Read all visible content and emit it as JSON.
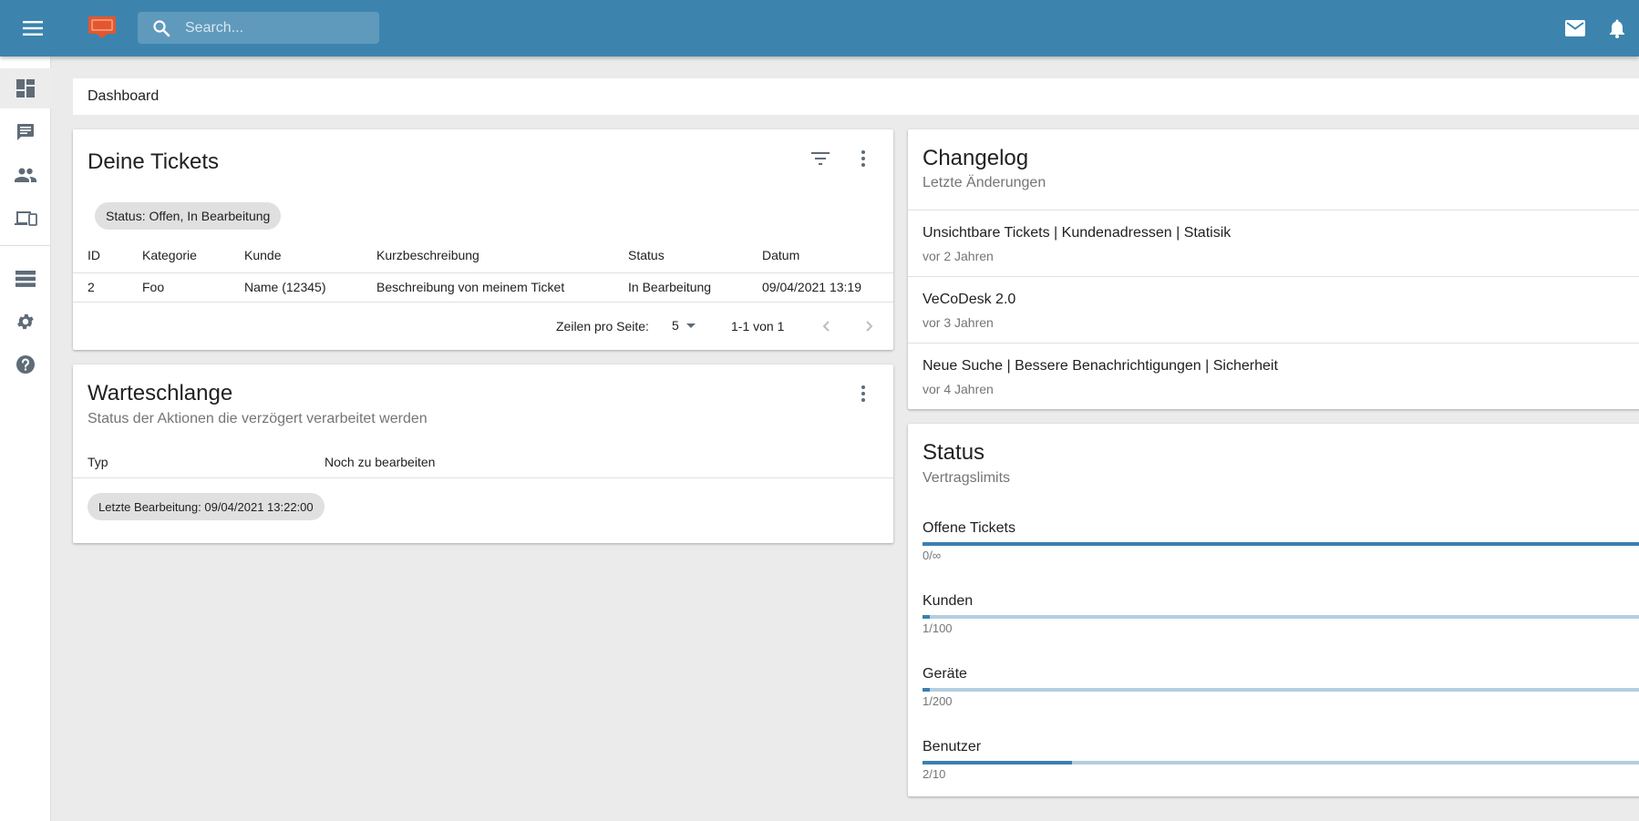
{
  "topbar": {
    "search_placeholder": "Search..."
  },
  "colors": {
    "topbar": "#3c84ae",
    "logo": "#e4572e",
    "progress_fill": "#3c7fb1",
    "progress_track": "#b3cee0"
  },
  "sidebar": {
    "items": [
      {
        "icon": "dashboard-icon",
        "active": true
      },
      {
        "icon": "chat-icon"
      },
      {
        "icon": "people-icon"
      },
      {
        "icon": "devices-icon"
      },
      {
        "icon": "list-icon"
      },
      {
        "icon": "gear-icon"
      },
      {
        "icon": "help-icon"
      }
    ]
  },
  "breadcrumb": {
    "title": "Dashboard"
  },
  "tickets": {
    "title": "Deine Tickets",
    "filter_chip": "Status: Offen, In Bearbeitung",
    "columns": [
      "ID",
      "Kategorie",
      "Kunde",
      "Kurzbeschreibung",
      "Status",
      "Datum"
    ],
    "rows": [
      [
        "2",
        "Foo",
        "Name (12345)",
        "Beschreibung von meinem Ticket",
        "In Bearbeitung",
        "09/04/2021 13:19"
      ]
    ],
    "pagination": {
      "rows_per_page_label": "Zeilen pro Seite:",
      "rows_per_page": "5",
      "range": "1-1 von 1"
    }
  },
  "queue": {
    "title": "Warteschlange",
    "subtitle": "Status der Aktionen die verzögert verarbeitet werden",
    "columns": [
      "Typ",
      "Noch zu bearbeiten"
    ],
    "last_edit_chip": "Letzte Bearbeitung: 09/04/2021 13:22:00"
  },
  "changelog": {
    "title": "Changelog",
    "subtitle": "Letzte Änderungen",
    "items": [
      {
        "title": "Unsichtbare Tickets | Kundenadressen | Statisik",
        "time": "vor 2 Jahren"
      },
      {
        "title": "VeCoDesk 2.0",
        "time": "vor 3 Jahren"
      },
      {
        "title": "Neue Suche | Bessere Benachrichtigungen | Sicherheit",
        "time": "vor 4 Jahren"
      }
    ]
  },
  "status": {
    "title": "Status",
    "subtitle": "Vertragslimits",
    "limits": [
      {
        "label": "Offene Tickets",
        "value": "0/∞",
        "fraction": 1.0
      },
      {
        "label": "Kunden",
        "value": "1/100",
        "fraction": 0.01
      },
      {
        "label": "Geräte",
        "value": "1/200",
        "fraction": 0.005
      },
      {
        "label": "Benutzer",
        "value": "2/10",
        "fraction": 0.2
      }
    ]
  }
}
